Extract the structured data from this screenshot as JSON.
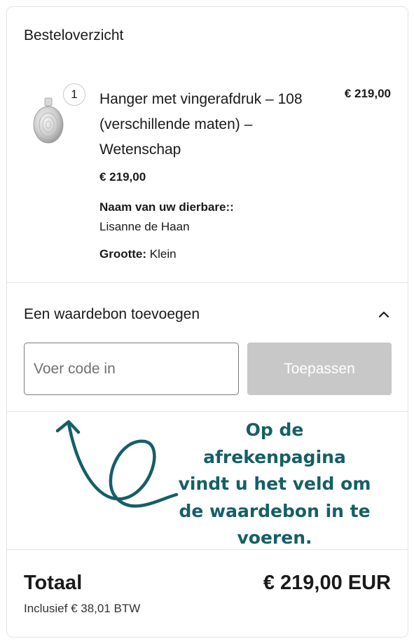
{
  "summary": {
    "title": "Besteloverzicht"
  },
  "item": {
    "quantity": "1",
    "name": "Hanger met vingerafdruk – 108 (verschillende maten) – Wetenschap",
    "line_price": "€ 219,00",
    "unit_price": "€ 219,00",
    "property_label": "Naam van uw dierbare::",
    "property_value": "Lisanne de Haan",
    "size_label": "Grootte:",
    "size_value": "Klein",
    "thumbnail_icon": "pendant-thumbnail"
  },
  "voucher": {
    "title": "Een waardebon toevoegen",
    "toggle_icon": "chevron-up-icon",
    "input_placeholder": "Voer code in",
    "input_value": "",
    "apply_label": "Toepassen"
  },
  "annotation": {
    "lines": [
      "Op de",
      "afrekenpagina",
      "vindt u het veld om",
      "de waardebon in te",
      "voeren."
    ],
    "color": "#155f66"
  },
  "totals": {
    "label": "Totaal",
    "value": "€ 219,00 EUR",
    "tax_note": "Inclusief € 38,01 BTW"
  }
}
